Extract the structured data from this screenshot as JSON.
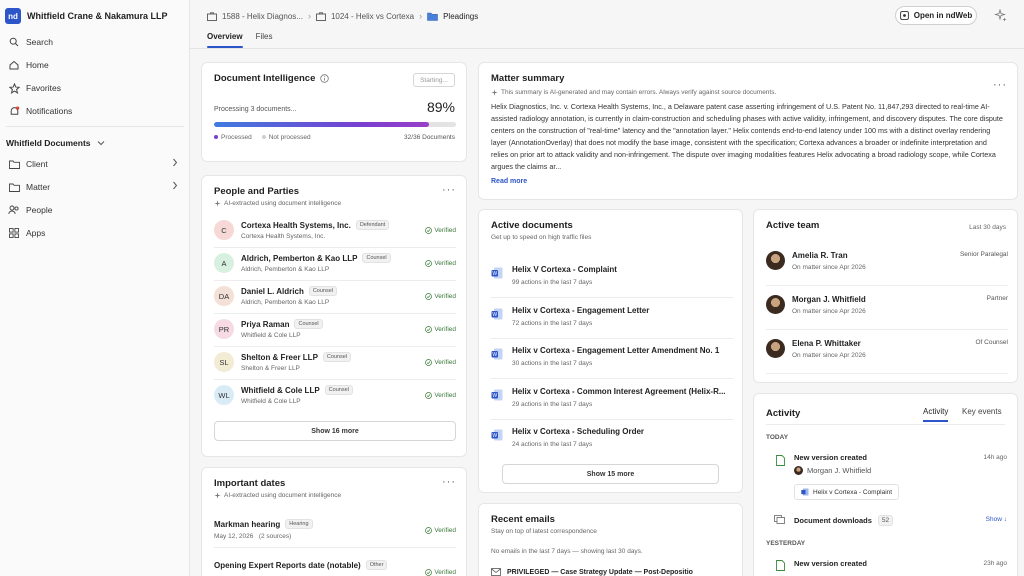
{
  "firm": {
    "logo": "nd",
    "name": "Whitfield Crane & Nakamura LLP"
  },
  "nav": [
    {
      "label": "Search",
      "icon": "search-icon"
    },
    {
      "label": "Home",
      "icon": "home-icon"
    },
    {
      "label": "Favorites",
      "icon": "star-icon"
    },
    {
      "label": "Notifications",
      "icon": "bell-icon"
    }
  ],
  "docs_section": {
    "title": "Whitfield Documents",
    "items": [
      {
        "label": "Client",
        "icon": "folder-icon"
      },
      {
        "label": "Matter",
        "icon": "folder-icon"
      },
      {
        "label": "People",
        "icon": "people-icon"
      },
      {
        "label": "Apps",
        "icon": "apps-icon"
      }
    ]
  },
  "breadcrumb": [
    "1588 - Helix Diagnos...",
    "1024 - Helix vs Cortexa",
    "Pleadings"
  ],
  "open_button": "Open in ndWeb",
  "tabs": [
    "Overview",
    "Files"
  ],
  "doc_intel": {
    "title": "Document Intelligence",
    "status": "Starting...",
    "processing": "Processing 3 documents...",
    "percent": "89%",
    "progress": 0.89,
    "legend_processed": "Processed",
    "legend_not": "Not processed",
    "count": "32/36 Documents",
    "colors": {
      "processed": "#7a3fd0",
      "not": "#cfcfcf"
    }
  },
  "people": {
    "title": "People and Parties",
    "subtitle": "AI-extracted using document intelligence",
    "verified": "Verified",
    "items": [
      {
        "initials": "C",
        "name": "Cortexa Health Systems, Inc.",
        "role": "Defendant",
        "org": "Cortexa Health Systems, Inc.",
        "color": "#f6d9d6"
      },
      {
        "initials": "A",
        "name": "Aldrich, Pemberton & Kao LLP",
        "role": "Counsel",
        "org": "Aldrich, Pemberton & Kao LLP",
        "color": "#d8f0e0"
      },
      {
        "initials": "DA",
        "name": "Daniel L. Aldrich",
        "role": "Counsel",
        "org": "Aldrich, Pemberton & Kao LLP",
        "color": "#f3e0d6"
      },
      {
        "initials": "PR",
        "name": "Priya Raman",
        "role": "Counsel",
        "org": "Whitfield & Cole LLP",
        "color": "#f6dbe4"
      },
      {
        "initials": "SL",
        "name": "Shelton & Freer LLP",
        "role": "Counsel",
        "org": "Shelton & Freer LLP",
        "color": "#f3ecd4"
      },
      {
        "initials": "WL",
        "name": "Whitfield & Cole LLP",
        "role": "Counsel",
        "org": "Whitfield & Cole LLP",
        "color": "#d9ecf6"
      }
    ],
    "show_more": "Show 16 more"
  },
  "dates": {
    "title": "Important dates",
    "subtitle": "AI-extracted using document intelligence",
    "items": [
      {
        "name": "Markman hearing",
        "tag": "Hearing",
        "date": "May 12, 2026",
        "sources": "(2 sources)",
        "status": "Verified"
      },
      {
        "name": "Opening Expert Reports date (notable)",
        "tag": "Other",
        "date": "",
        "sources": "",
        "status": "Verified"
      }
    ]
  },
  "summary": {
    "title": "Matter summary",
    "disclaimer": "This summary is AI-generated and may contain errors. Always verify against source documents.",
    "text": "Helix Diagnostics, Inc. v. Cortexa Health Systems, Inc., a Delaware patent case asserting infringement of U.S. Patent No. 11,847,293 directed to real-time AI-assisted radiology annotation, is currently in claim-construction and scheduling phases with active validity, infringement, and discovery disputes. The core dispute centers on the construction of \"real-time\" latency and the \"annotation layer.\" Helix contends end-to-end latency under 100 ms with a distinct overlay rendering layer (AnnotationOverlay) that does not modify the base image, consistent with the specification; Cortexa advances a broader or indefinite interpretation and relies on prior art to attack validity and non-infringement. The dispute over imaging modalities features Helix advocating a broad radiology scope, while Cortexa argues the claims ar...",
    "read_more": "Read more"
  },
  "active_docs": {
    "title": "Active documents",
    "subtitle": "Get up to speed on high traffic files",
    "items": [
      {
        "title": "Helix V Cortexa - Complaint",
        "actions": "99 actions in the last 7 days"
      },
      {
        "title": "Helix v Cortexa - Engagement Letter",
        "actions": "72 actions in the last 7 days"
      },
      {
        "title": "Helix v Cortexa - Engagement Letter Amendment No. 1",
        "actions": "30 actions in the last 7 days"
      },
      {
        "title": "Helix v Cortexa - Common Interest Agreement (Helix-R...",
        "actions": "29 actions in the last 7 days"
      },
      {
        "title": "Helix v Cortexa - Scheduling Order",
        "actions": "24 actions in the last 7 days"
      }
    ],
    "show_more": "Show 15 more"
  },
  "emails": {
    "title": "Recent emails",
    "subtitle": "Stay on top of latest correspondence",
    "note": "No emails in the last 7 days — showing last 30 days.",
    "first": "PRIVILEGED — Case Strategy Update — Post-Depositio"
  },
  "team": {
    "title": "Active team",
    "period": "Last 30 days",
    "members": [
      {
        "name": "Amelia R. Tran",
        "since": "On matter since Apr 2026",
        "role": "Senior Paralegal"
      },
      {
        "name": "Morgan J. Whitfield",
        "since": "On matter since Apr 2026",
        "role": "Partner"
      },
      {
        "name": "Elena P. Whittaker",
        "since": "On matter since Apr 2026",
        "role": "Of Counsel"
      }
    ]
  },
  "activity": {
    "title": "Activity",
    "tabs": [
      "Activity",
      "Key events"
    ],
    "today": "TODAY",
    "e1_title": "New version created",
    "e1_time": "14h ago",
    "e1_user": "Morgan J. Whitfield",
    "e1_doc": "Helix v Cortexa - Complaint",
    "e2_title": "Document downloads",
    "e2_count": "52",
    "e2_show": "Show ↓",
    "yesterday": "YESTERDAY",
    "e3_title": "New version created",
    "e3_time": "23h ago"
  }
}
